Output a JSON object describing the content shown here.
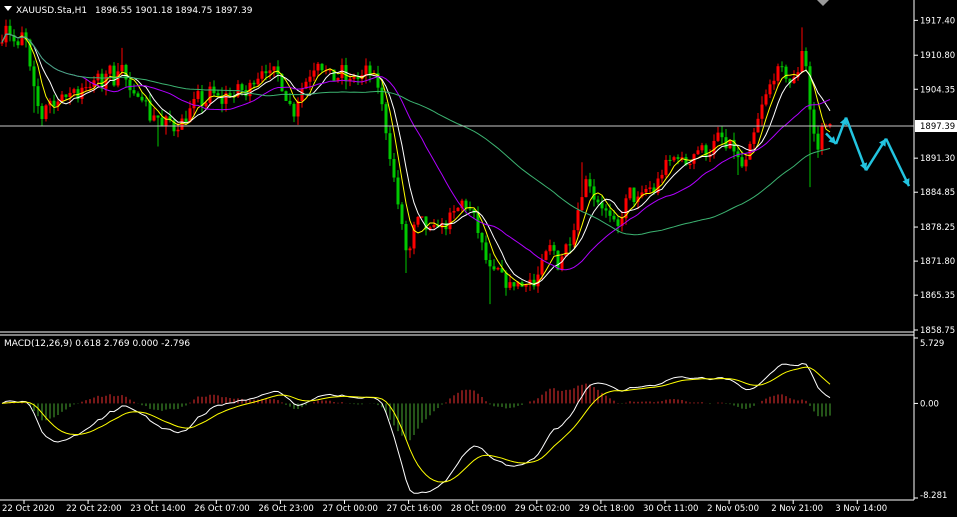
{
  "window": {
    "symbol_header": "XAUUSD.Sta,H1",
    "ohlc_values": "1896.55 1901.18 1894.75 1897.39",
    "macd_header": "MACD(12,26,9) 0.618 2.769 0.000 -2.796",
    "current_price_label": "1897.39"
  },
  "colors": {
    "background": "#000000",
    "panel_border": "#ffffff",
    "bull_candle": "#ff0000",
    "bear_candle": "#00c800",
    "ma_fast": "#ffff00",
    "ma_mid": "#ffffff",
    "ma_slow": "#b000ff",
    "ma_long": "#3cb371",
    "macd_hist_pos": "#c82828",
    "macd_hist_neg": "#3c8c28",
    "macd_line": "#ffffff",
    "signal_line": "#ffff00",
    "forecast_arrow": "#22c4e0"
  },
  "chart_data": [
    {
      "type": "candlestick",
      "title": "XAUUSD.Sta,H1",
      "timeframe": "H1",
      "y_ticks": [
        "1917.40",
        "1910.80",
        "1904.35",
        "1897.39",
        "1891.30",
        "1884.85",
        "1878.25",
        "1871.80",
        "1865.35",
        "1858.75"
      ],
      "ylim": [
        1858.75,
        1920.5
      ],
      "last_price": 1897.39,
      "x_tick_labels": [
        "22 Oct 2020",
        "22 Oct 22:00",
        "23 Oct 14:00",
        "26 Oct 07:00",
        "26 Oct 23:00",
        "27 Oct 00:00",
        "27 Oct 16:00",
        "28 Oct 09:00",
        "29 Oct 02:00",
        "29 Oct 18:00",
        "30 Oct 11:00",
        "2 Nov 05:00",
        "2 Nov 21:00",
        "3 Nov 14:00"
      ],
      "price_path": [
        [
          0,
          1913
        ],
        [
          6,
          1917
        ],
        [
          12,
          1914
        ],
        [
          18,
          1912
        ],
        [
          24,
          1916
        ],
        [
          30,
          1908
        ],
        [
          36,
          1902
        ],
        [
          42,
          1899
        ],
        [
          48,
          1903
        ],
        [
          54,
          1901
        ],
        [
          60,
          1904
        ],
        [
          66,
          1902
        ],
        [
          72,
          1905
        ],
        [
          78,
          1903
        ],
        [
          84,
          1906
        ],
        [
          90,
          1904
        ],
        [
          96,
          1907
        ],
        [
          102,
          1905
        ],
        [
          108,
          1909
        ],
        [
          114,
          1906
        ],
        [
          120,
          1910
        ],
        [
          126,
          1906
        ],
        [
          132,
          1902
        ],
        [
          138,
          1904
        ],
        [
          144,
          1903
        ],
        [
          150,
          1899
        ],
        [
          156,
          1900
        ],
        [
          162,
          1897
        ],
        [
          168,
          1899
        ],
        [
          174,
          1897
        ],
        [
          180,
          1898
        ],
        [
          186,
          1899
        ],
        [
          192,
          1901
        ],
        [
          198,
          1903
        ],
        [
          204,
          1901
        ],
        [
          210,
          1904
        ],
        [
          216,
          1903
        ],
        [
          222,
          1902
        ],
        [
          228,
          1904
        ],
        [
          234,
          1903
        ],
        [
          240,
          1905
        ],
        [
          246,
          1903
        ],
        [
          252,
          1906
        ],
        [
          258,
          1907
        ],
        [
          264,
          1909
        ],
        [
          270,
          1907
        ],
        [
          276,
          1908
        ],
        [
          282,
          1905
        ],
        [
          288,
          1902
        ],
        [
          294,
          1900
        ],
        [
          300,
          1904
        ],
        [
          306,
          1906
        ],
        [
          312,
          1908
        ],
        [
          318,
          1910
        ],
        [
          324,
          1908
        ],
        [
          330,
          1907
        ],
        [
          336,
          1906
        ],
        [
          342,
          1908
        ],
        [
          348,
          1905
        ],
        [
          354,
          1907
        ],
        [
          360,
          1906
        ],
        [
          366,
          1908
        ],
        [
          372,
          1907
        ],
        [
          378,
          1905
        ],
        [
          384,
          1899
        ],
        [
          390,
          1892
        ],
        [
          396,
          1885
        ],
        [
          402,
          1878
        ],
        [
          408,
          1872
        ],
        [
          414,
          1878
        ],
        [
          420,
          1880
        ],
        [
          426,
          1878
        ],
        [
          432,
          1877
        ],
        [
          438,
          1879
        ],
        [
          444,
          1878
        ],
        [
          450,
          1880
        ],
        [
          456,
          1881
        ],
        [
          462,
          1883
        ],
        [
          468,
          1882
        ],
        [
          474,
          1880
        ],
        [
          480,
          1876
        ],
        [
          486,
          1872
        ],
        [
          492,
          1869
        ],
        [
          498,
          1870
        ],
        [
          504,
          1868
        ],
        [
          510,
          1867
        ],
        [
          516,
          1868
        ],
        [
          522,
          1867
        ],
        [
          528,
          1869
        ],
        [
          534,
          1867
        ],
        [
          540,
          1870
        ],
        [
          546,
          1873
        ],
        [
          552,
          1875
        ],
        [
          558,
          1871
        ],
        [
          564,
          1874
        ],
        [
          570,
          1876
        ],
        [
          576,
          1880
        ],
        [
          582,
          1885
        ],
        [
          588,
          1888
        ],
        [
          594,
          1884
        ],
        [
          600,
          1883
        ],
        [
          606,
          1881
        ],
        [
          612,
          1879
        ],
        [
          618,
          1878
        ],
        [
          624,
          1882
        ],
        [
          630,
          1885
        ],
        [
          636,
          1883
        ],
        [
          642,
          1884
        ],
        [
          648,
          1886
        ],
        [
          654,
          1885
        ],
        [
          660,
          1888
        ],
        [
          666,
          1890
        ],
        [
          672,
          1891
        ],
        [
          678,
          1892
        ],
        [
          684,
          1890
        ],
        [
          690,
          1891
        ],
        [
          696,
          1893
        ],
        [
          702,
          1893
        ],
        [
          708,
          1892
        ],
        [
          714,
          1894
        ],
        [
          720,
          1896
        ],
        [
          726,
          1893
        ],
        [
          732,
          1894
        ],
        [
          738,
          1891
        ],
        [
          744,
          1889
        ],
        [
          750,
          1893
        ],
        [
          756,
          1897
        ],
        [
          762,
          1901
        ],
        [
          768,
          1904
        ],
        [
          774,
          1907
        ],
        [
          780,
          1908
        ],
        [
          786,
          1907
        ],
        [
          792,
          1905
        ],
        [
          798,
          1908
        ],
        [
          804,
          1914
        ],
        [
          808,
          1904
        ],
        [
          812,
          1897
        ],
        [
          818,
          1893
        ],
        [
          824,
          1899
        ],
        [
          830,
          1897
        ]
      ],
      "forecast_path": [
        [
          826,
          1896
        ],
        [
          836,
          1894
        ],
        [
          846,
          1899
        ],
        [
          866,
          1889
        ],
        [
          886,
          1895
        ],
        [
          909,
          1886
        ]
      ]
    },
    {
      "type": "macd",
      "title": "MACD(12,26,9)",
      "params": [
        12,
        26,
        9
      ],
      "values": {
        "macd": 0.618,
        "signal": 2.769,
        "aux1": 0.0,
        "aux2": -2.796
      },
      "y_ticks": [
        "5.729",
        "0.00",
        "-8.281"
      ],
      "ylim": [
        -8.281,
        5.729
      ]
    }
  ]
}
